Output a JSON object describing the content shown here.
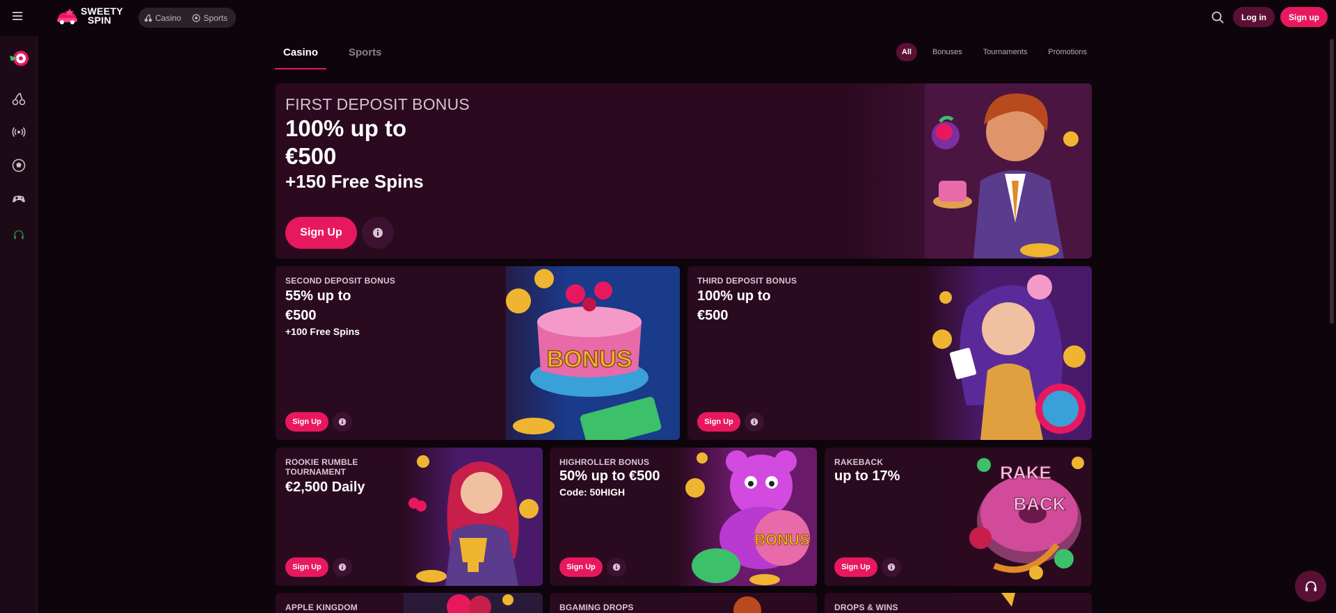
{
  "header": {
    "logo_line1": "SWEETY",
    "logo_line2": "SPIN",
    "switcher": {
      "casino": "Casino",
      "sports": "Sports"
    },
    "login": "Log in",
    "signup": "Sign up"
  },
  "sidebar": {
    "icons": [
      "wheel-of-fortune-icon",
      "cherries-icon",
      "live-broadcast-icon",
      "football-icon",
      "gamepad-icon",
      "headset-icon"
    ]
  },
  "tabs": [
    {
      "label": "Casino",
      "active": true
    },
    {
      "label": "Sports",
      "active": false
    }
  ],
  "filters": [
    {
      "label": "All",
      "active": true
    },
    {
      "label": "Bonuses",
      "active": false
    },
    {
      "label": "Tournaments",
      "active": false
    },
    {
      "label": "Promotions",
      "active": false
    }
  ],
  "hero": {
    "tag": "FIRST DEPOSIT BONUS",
    "line1": "100% up to",
    "line2": "€500",
    "line3": "+150 Free Spins",
    "cta": "Sign Up"
  },
  "cards": {
    "second": {
      "tag": "SECOND DEPOSIT BONUS",
      "line1": "55% up to",
      "line2": "€500",
      "line3": "+100 Free Spins",
      "cta": "Sign Up",
      "art_text": "BONUS"
    },
    "third": {
      "tag": "THIRD DEPOSIT BONUS",
      "line1": "100% up to",
      "line2": "€500",
      "cta": "Sign Up"
    },
    "rookie": {
      "tag1": "ROOKIE RUMBLE",
      "tag2": "TOURNAMENT",
      "line1": "€2,500 Daily",
      "cta": "Sign Up"
    },
    "highroller": {
      "tag": "HIGHROLLER BONUS",
      "line1": "50% up to €500",
      "line2": "Code: 50HIGH",
      "cta": "Sign Up",
      "art_text": "BONUS"
    },
    "rakeback": {
      "tag": "RAKEBACK",
      "line1": "up to 17%",
      "cta": "Sign Up",
      "art_text1": "RAKE",
      "art_text2": "BACK"
    },
    "apple": {
      "tag": "APPLE KINGDOM"
    },
    "bgaming": {
      "tag": "BGAMING DROPS"
    },
    "drops": {
      "tag": "DROPS & WINS"
    }
  },
  "colors": {
    "accent": "#e8185f",
    "background": "#0d050b",
    "card": "#2a0a1f",
    "sidebar": "#1c0b17"
  }
}
